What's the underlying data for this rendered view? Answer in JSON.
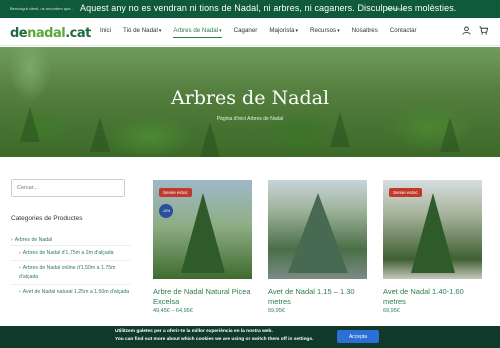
{
  "notice": {
    "small_left": "Benvolgut client, us recordem que...",
    "message": "Aquest any no es vendran ni tions de Nadal, ni arbres, ni caganers. Disculpeu les molèsties.",
    "small_right": "Benvolgut"
  },
  "header": {
    "logo_main": "de",
    "logo_dot": "nadal",
    "logo_suffix": ".cat",
    "nav": [
      {
        "label": "Inici",
        "dropdown": false
      },
      {
        "label": "Tió de Nadal",
        "dropdown": true
      },
      {
        "label": "Arbres de Nadal",
        "dropdown": true
      },
      {
        "label": "Caganer",
        "dropdown": false
      },
      {
        "label": "Majorista",
        "dropdown": true
      },
      {
        "label": "Recursos",
        "dropdown": true
      },
      {
        "label": "Nosaltres",
        "dropdown": false
      },
      {
        "label": "Contactar",
        "dropdown": false
      }
    ],
    "icons": [
      "user-icon",
      "cart-icon"
    ]
  },
  "hero": {
    "title": "Arbres de Nadal",
    "breadcrumb": "Pàgina d'inici   Arbres de Nadal"
  },
  "sidebar": {
    "search_placeholder": "Cercar...",
    "categories_title": "Categories de Productes",
    "items": [
      {
        "label": "Arbres de Nadal",
        "sub": false
      },
      {
        "label": "Arbres de Nadal d'1,75m a 2m d'alçada",
        "sub": true
      },
      {
        "label": "Arbres de Nadal online d'1.50m a 1.75m d'alçada",
        "sub": true
      },
      {
        "label": "Avet de Nadal natural 1.25m a 1.50m d'alçada",
        "sub": true
      }
    ]
  },
  "products": [
    {
      "name": "Arbre de Nadal Natural Picea Excelsa",
      "price": "49,45€ – 64,95€",
      "badge": "Sense estoc",
      "sale": "-10%"
    },
    {
      "name": "Avet de Nadal 1.15 – 1.30 metres",
      "price": "59,95€",
      "badge": "",
      "sale": ""
    },
    {
      "name": "Avet de Nadal 1.40-1.60 metres",
      "price": "69,95€",
      "badge": "Sense estoc",
      "sale": ""
    }
  ],
  "cookie": {
    "line1": "Utilitzem galetes per a oferir-te la millor experiència en la nostra web.",
    "line2": "You can find out more about which cookies we are using or switch them off in settings.",
    "accept": "Accepta"
  }
}
